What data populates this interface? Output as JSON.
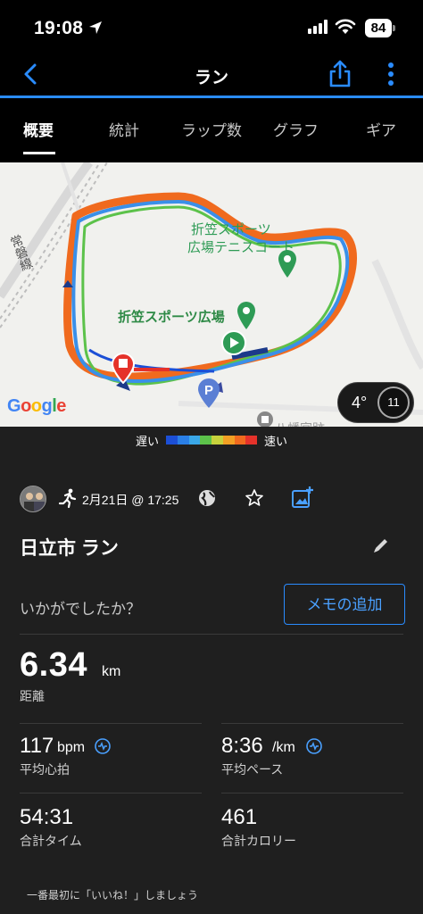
{
  "status_bar": {
    "time": "19:08",
    "battery": "84"
  },
  "nav": {
    "title": "ラン"
  },
  "tabs": [
    {
      "label": "概要",
      "active": true
    },
    {
      "label": "統計",
      "active": false
    },
    {
      "label": "ラップ数",
      "active": false
    },
    {
      "label": "グラフ",
      "active": false
    },
    {
      "label": "ギア",
      "active": false
    }
  ],
  "map": {
    "labels": {
      "tennis_line1": "折笠スポーツ",
      "tennis_line2": "広場テニスコート",
      "park": "折笠スポーツ広場",
      "railway": "常磐線",
      "partial": "八幡宮跡"
    },
    "google": "Google",
    "weather": {
      "temp": "4°",
      "wind": "11"
    }
  },
  "legend": {
    "slow": "遅い",
    "fast": "速い",
    "colors": [
      "#1c4fd6",
      "#2a7fe6",
      "#3aa7e8",
      "#5cc24a",
      "#c7d23c",
      "#f2a024",
      "#f06a1e",
      "#e5322a"
    ]
  },
  "activity": {
    "date": "2月21日 @ 17:25",
    "title": "日立市 ラン",
    "notes_prompt": "いかがでしたか？",
    "add_memo": "メモの追加"
  },
  "stats": {
    "distance": {
      "value": "6.34",
      "unit": "km",
      "label": "距離"
    },
    "heart_rate": {
      "value": "117",
      "unit": "bpm",
      "label": "平均心拍"
    },
    "pace": {
      "value": "8:36",
      "unit": "/km",
      "label": "平均ペース"
    },
    "time": {
      "value": "54:31",
      "label": "合計タイム"
    },
    "calories": {
      "value": "461",
      "label": "合計カロリー"
    }
  },
  "footer": {
    "like_prompt": "一番最初に「いいね！」しましょう"
  }
}
